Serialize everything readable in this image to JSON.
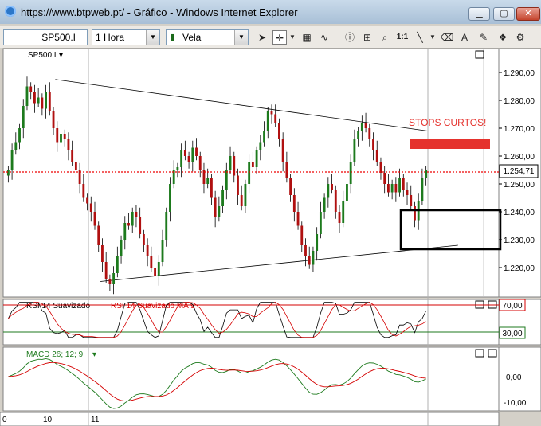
{
  "window": {
    "title": "https://www.btpweb.pt/ - Gráfico - Windows Internet Explorer",
    "minimize_icon": "minimize-icon",
    "maximize_icon": "maximize-icon",
    "close_icon": "close-icon"
  },
  "toolbar": {
    "symbol": "SP500.I",
    "timeframe": "1 Hora",
    "chart_style": "Vela",
    "zoom_label": "1:1",
    "icons": [
      "cursor-icon",
      "crosshair-icon",
      "line-tool-icon",
      "text-tool-icon",
      "zoom-icon",
      "line-draw-icon",
      "eraser-icon",
      "pencil-icon",
      "layers-icon"
    ]
  },
  "price_panel": {
    "symbol_label": "SP500.I",
    "current_price": "1.254,71",
    "annotation": "STOPS CURTOS!",
    "annotation_color": "#e5322d",
    "y_ticks": [
      "1.290,00",
      "1.280,00",
      "1.270,00",
      "1.260,00",
      "1.250,00",
      "1.240,00",
      "1.230,00",
      "1.220,00"
    ]
  },
  "rsi_panel": {
    "label": "RSI 14 Suavizado",
    "ma_label": "RSI 14 Suavizado MA 9",
    "upper": "70,00",
    "lower": "30,00",
    "upper_color": "#d40000",
    "lower_color": "#1d7a1d"
  },
  "macd_panel": {
    "label": "MACD 26; 12; 9",
    "y_ticks": [
      "0,00",
      "-10,00"
    ]
  },
  "x_axis": {
    "labels": [
      "0",
      "10",
      "11"
    ]
  },
  "chart_data": {
    "type": "candlestick",
    "price_ylim": [
      1210,
      1295
    ],
    "closes": [
      1255,
      1262,
      1265,
      1270,
      1278,
      1285,
      1283,
      1279,
      1281,
      1277,
      1283,
      1276,
      1270,
      1265,
      1268,
      1266,
      1262,
      1258,
      1255,
      1250,
      1245,
      1243,
      1240,
      1235,
      1228,
      1222,
      1216,
      1214,
      1218,
      1224,
      1230,
      1236,
      1235,
      1240,
      1238,
      1232,
      1228,
      1224,
      1220,
      1217,
      1222,
      1230,
      1240,
      1250,
      1255,
      1256,
      1262,
      1260,
      1258,
      1263,
      1260,
      1255,
      1250,
      1252,
      1245,
      1238,
      1242,
      1248,
      1255,
      1260,
      1253,
      1246,
      1242,
      1250,
      1258,
      1256,
      1262,
      1265,
      1269,
      1276,
      1275,
      1272,
      1266,
      1258,
      1252,
      1246,
      1240,
      1235,
      1228,
      1224,
      1221,
      1226,
      1232,
      1240,
      1245,
      1250,
      1248,
      1240,
      1236,
      1244,
      1250,
      1258,
      1266,
      1269,
      1272,
      1270,
      1266,
      1262,
      1258,
      1254,
      1250,
      1247,
      1250,
      1247,
      1252,
      1248,
      1246,
      1242,
      1237,
      1244,
      1252,
      1255
    ],
    "rsi_ylim": [
      20,
      75
    ],
    "rsi_upper_level": 70,
    "rsi_lower_level": 30,
    "macd_ylim": [
      -14,
      10
    ],
    "trendline_upper": [
      [
        13,
        1287.5
      ],
      [
        112,
        1269
      ]
    ],
    "trendline_lower": [
      [
        25,
        1215
      ],
      [
        120,
        1228
      ]
    ]
  }
}
